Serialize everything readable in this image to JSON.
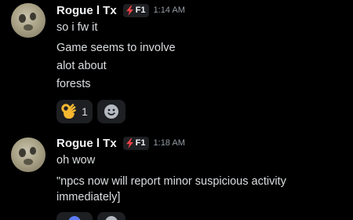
{
  "messages": [
    {
      "username": "Rogue l Tx",
      "tag": "F1",
      "tag_icon": "lightning-bolt-icon",
      "timestamp": "1:14 AM",
      "lines": [
        "so i fw it",
        "Game seems to involve",
        "alot about",
        "forests"
      ],
      "reactions": [
        {
          "emoji": "ok-hand-emoji",
          "count": "1"
        },
        {
          "emoji": "add-reaction-icon"
        }
      ]
    },
    {
      "username": "Rogue l Tx",
      "tag": "F1",
      "tag_icon": "lightning-bolt-icon",
      "timestamp": "1:18 AM",
      "lines": [
        "oh wow",
        "\"npcs now will report minor suspicious activity",
        "immediately]"
      ]
    }
  ],
  "colors": {
    "background": "#000000",
    "username": "#f2f3f5",
    "message_text": "#dbdee1",
    "timestamp": "#949ba4",
    "reaction_bg": "#1e1f22",
    "bolt_red": "#ed4245",
    "ok_hand": "#f7b731"
  }
}
